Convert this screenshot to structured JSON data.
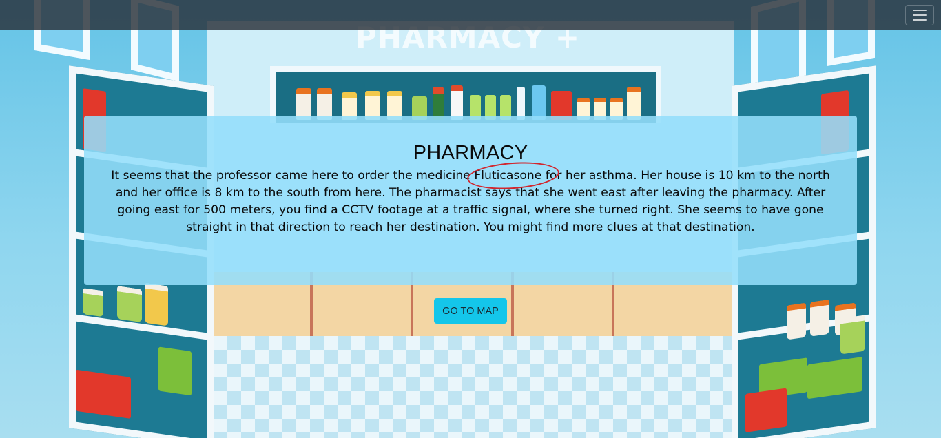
{
  "navbar": {
    "menu_icon": "hamburger-menu-icon"
  },
  "background": {
    "sign_text": "PHARMACY +"
  },
  "card": {
    "title": "PHARMACY",
    "story_before": "It seems that the professor came here to order the medicine ",
    "highlight": "Fluticasone",
    "story_after": " for her asthma. Her house is 10 km to the north and her office is 8 km to the south from here. The pharmacist says that she went east after leaving the pharmacy. After going east for 500 meters, you find a CCTV footage at a traffic signal, where she turned right. She seems to have gone straight in that direction to reach her destination. You might find more clues at that destination."
  },
  "actions": {
    "go_to_map_label": "GO TO MAP"
  },
  "colors": {
    "navbar": "#283038",
    "card": "#94defa",
    "button": "#14c6ea",
    "highlight_circle": "#d2262d"
  }
}
